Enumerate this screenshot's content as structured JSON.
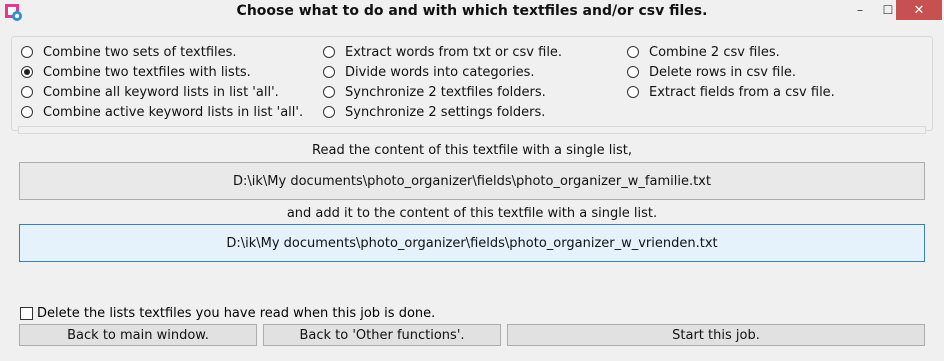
{
  "window": {
    "title": "Choose what to do and with which textfiles and/or csv files.",
    "min_glyph": "–",
    "max_glyph": "☐",
    "close_glyph": "✕",
    "app_icon": "app-logo-icon"
  },
  "options": {
    "col1": [
      {
        "label": "Combine two sets of textfiles.",
        "checked": false
      },
      {
        "label": "Combine two textfiles with lists.",
        "checked": true
      },
      {
        "label": "Combine all keyword lists in list 'all'.",
        "checked": false
      },
      {
        "label": "Combine active keyword lists in list 'all'.",
        "checked": false
      }
    ],
    "col2": [
      {
        "label": "Extract words from txt or csv file.",
        "checked": false
      },
      {
        "label": "Divide words into categories.",
        "checked": false
      },
      {
        "label": "Synchronize 2 textfiles folders.",
        "checked": false
      },
      {
        "label": "Synchronize 2 settings folders.",
        "checked": false
      }
    ],
    "col3": [
      {
        "label": "Combine 2 csv files.",
        "checked": false
      },
      {
        "label": "Delete rows in csv file.",
        "checked": false
      },
      {
        "label": "Extract fields from a csv file.",
        "checked": false
      }
    ]
  },
  "source": {
    "caption": "Read the content of this textfile with a single list,",
    "path": "D:\\ik\\My documents\\photo_organizer\\fields\\photo_organizer_w_familie.txt"
  },
  "target": {
    "caption": "and add it to the content of this textfile with a single list.",
    "path": "D:\\ik\\My documents\\photo_organizer\\fields\\photo_organizer_w_vrienden.txt"
  },
  "delete_option": {
    "label": "Delete the lists textfiles you have read when this job is done.",
    "checked": false
  },
  "buttons": {
    "back_main": "Back to main window.",
    "back_other": "Back to 'Other functions'.",
    "start": "Start this job."
  }
}
